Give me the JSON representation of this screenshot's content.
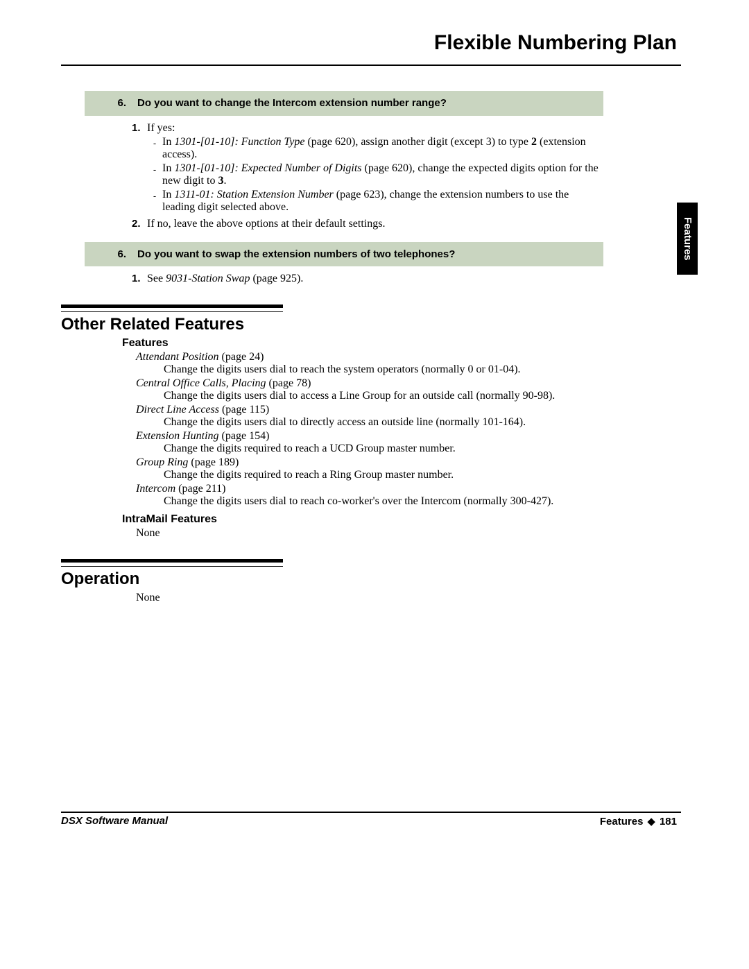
{
  "header": {
    "title": "Flexible Numbering Plan"
  },
  "sideTab": "Features",
  "bar1": {
    "num": "6.",
    "text": "Do you want to change the Intercom extension number range?"
  },
  "bar1_list": {
    "l1num": "1.",
    "l1text_a": "If yes:",
    "d1_prefix": "In ",
    "d1_ref": "1301-[01-10]: Function Type",
    "d1_rest_a": " (page 620), assign another digit (except 3) to type ",
    "d1_bold": "2",
    "d1_rest_b": " (extension access).",
    "d2_prefix": "In ",
    "d2_ref": "1301-[01-10]: Expected Number of Digits",
    "d2_rest_a": " (page 620), change the expected digits option for the new digit to ",
    "d2_bold": "3",
    "d2_rest_b": ".",
    "d3_prefix": "In ",
    "d3_ref": "1311-01: Station Extension Number",
    "d3_rest": " (page 623), change the extension numbers to use the leading digit selected above.",
    "l2num": "2.",
    "l2text": "If no, leave the above options at their default settings."
  },
  "bar2": {
    "num": "6.",
    "text": "Do you want to swap the extension numbers of two telephones?"
  },
  "bar2_list": {
    "l1num": "1.",
    "l1_a": "See ",
    "l1_ref": "9031-Station Swap",
    "l1_b": " (page 925)."
  },
  "sections": {
    "related_title": "Other Related Features",
    "features_sub": "Features",
    "f1_t": "Attendant Position",
    "f1_p": " (page 24)",
    "f1_d": "Change the digits users dial to reach the system operators (normally 0 or 01-04).",
    "f2_t": "Central Office Calls, Placing",
    "f2_p": " (page 78)",
    "f2_d": "Change the digits users dial to access a Line Group for an outside call (normally 90-98).",
    "f3_t": "Direct Line Access",
    "f3_p": " (page 115)",
    "f3_d": "Change the digits users dial to directly access an outside line (normally 101-164).",
    "f4_t": "Extension Hunting",
    "f4_p": " (page 154)",
    "f4_d": "Change the digits required to reach a UCD Group master number.",
    "f5_t": "Group Ring",
    "f5_p": " (page 189)",
    "f5_d": "Change the digits required to reach a Ring Group master number.",
    "f6_t": "Intercom",
    "f6_p": " (page 211)",
    "f6_d": "Change the digits users dial to reach co-worker's over the Intercom (normally 300-427).",
    "intramail_sub": "IntraMail Features",
    "intramail_none": "None",
    "operation_title": "Operation",
    "operation_none": "None"
  },
  "footer": {
    "left": "DSX Software Manual",
    "right_label": "Features",
    "right_sep": "◆",
    "right_page": "181"
  }
}
